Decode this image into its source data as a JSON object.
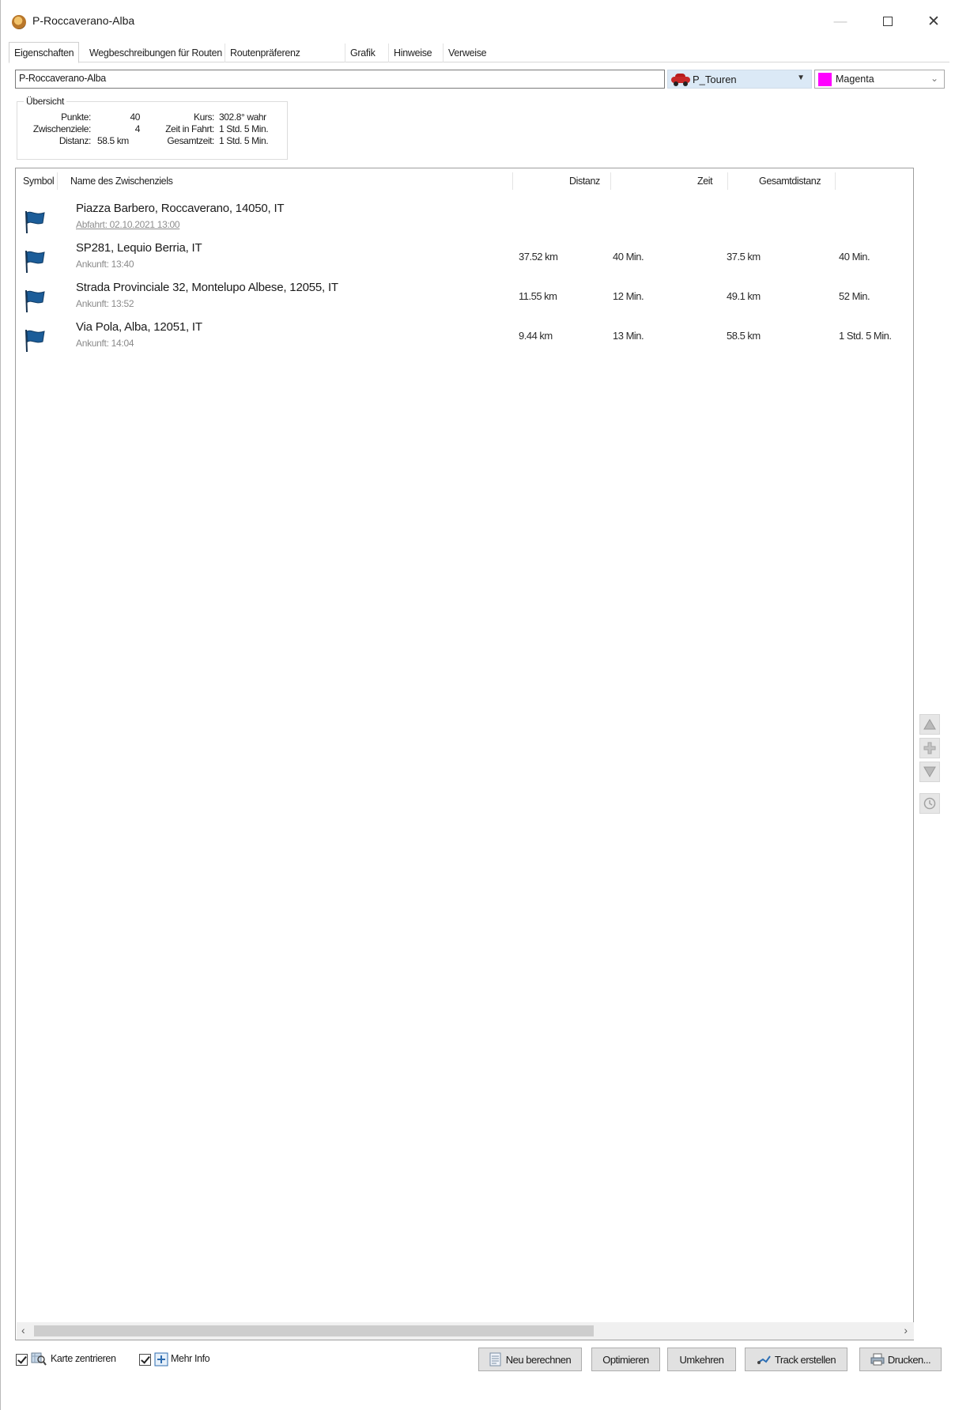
{
  "window": {
    "title": "P-Roccaverano-Alba",
    "minimize_glyph": "—",
    "close_glyph": "✕"
  },
  "tabs": [
    {
      "label": "Eigenschaften",
      "active": true
    },
    {
      "label": "Wegbeschreibungen für Routen",
      "active": false
    },
    {
      "label": "Routenpräferenz",
      "active": false
    },
    {
      "label": "Grafik",
      "active": false
    },
    {
      "label": "Hinweise",
      "active": false
    },
    {
      "label": "Verweise",
      "active": false
    }
  ],
  "route": {
    "name": "P-Roccaverano-Alba",
    "profile": "P_Touren",
    "color_name": "Magenta",
    "color_hex": "#ff00ff"
  },
  "overview": {
    "legend": "Übersicht",
    "points_label": "Punkte:",
    "points_value": "40",
    "waypoints_label": "Zwischenziele:",
    "waypoints_value": "4",
    "distance_label": "Distanz:",
    "distance_value": "58.5 km",
    "course_label": "Kurs:",
    "course_value": "302.8° wahr",
    "drive_time_label": "Zeit in Fahrt:",
    "drive_time_value": "1 Std. 5 Min.",
    "total_time_label": "Gesamtzeit:",
    "total_time_value": "1 Std. 5 Min."
  },
  "columns": {
    "symbol": "Symbol",
    "name": "Name des Zwischenziels",
    "distance": "Distanz",
    "time": "Zeit",
    "total_distance": "Gesamtdistanz"
  },
  "rows": [
    {
      "name": "Piazza Barbero, Roccaverano, 14050, IT",
      "sub": "Abfahrt: 02.10.2021 13:00",
      "distance": "",
      "time": "",
      "total_distance": "",
      "total_time": "",
      "icon": "blue-flag-icon"
    },
    {
      "name": "SP281, Lequio Berria, IT",
      "sub": "Ankunft: 13:40",
      "distance": "37.52 km",
      "time": "40 Min.",
      "total_distance": "37.5 km",
      "total_time": "40 Min.",
      "icon": "blue-flag-icon"
    },
    {
      "name": "Strada Provinciale 32, Montelupo Albese, 12055, IT",
      "sub": "Ankunft: 13:52",
      "distance": "11.55 km",
      "time": "12 Min.",
      "total_distance": "49.1 km",
      "total_time": "52 Min.",
      "icon": "blue-flag-icon"
    },
    {
      "name": "Via Pola, Alba, 12051, IT",
      "sub": "Ankunft: 14:04",
      "distance": "9.44 km",
      "time": "13 Min.",
      "total_distance": "58.5 km",
      "total_time": "1 Std. 5 Min.",
      "icon": "blue-flag-icon"
    }
  ],
  "scrollbar": {
    "left": "‹",
    "right": "›"
  },
  "side_buttons": [
    "move-up-icon",
    "add-icon",
    "move-down-icon",
    "clock-icon"
  ],
  "bottom": {
    "center_map_label": "Karte zentrieren",
    "more_info_label": "Mehr Info",
    "recalculate": "Neu berechnen",
    "optimize": "Optimieren",
    "reverse": "Umkehren",
    "create_track": "Track erstellen",
    "print": "Drucken..."
  }
}
